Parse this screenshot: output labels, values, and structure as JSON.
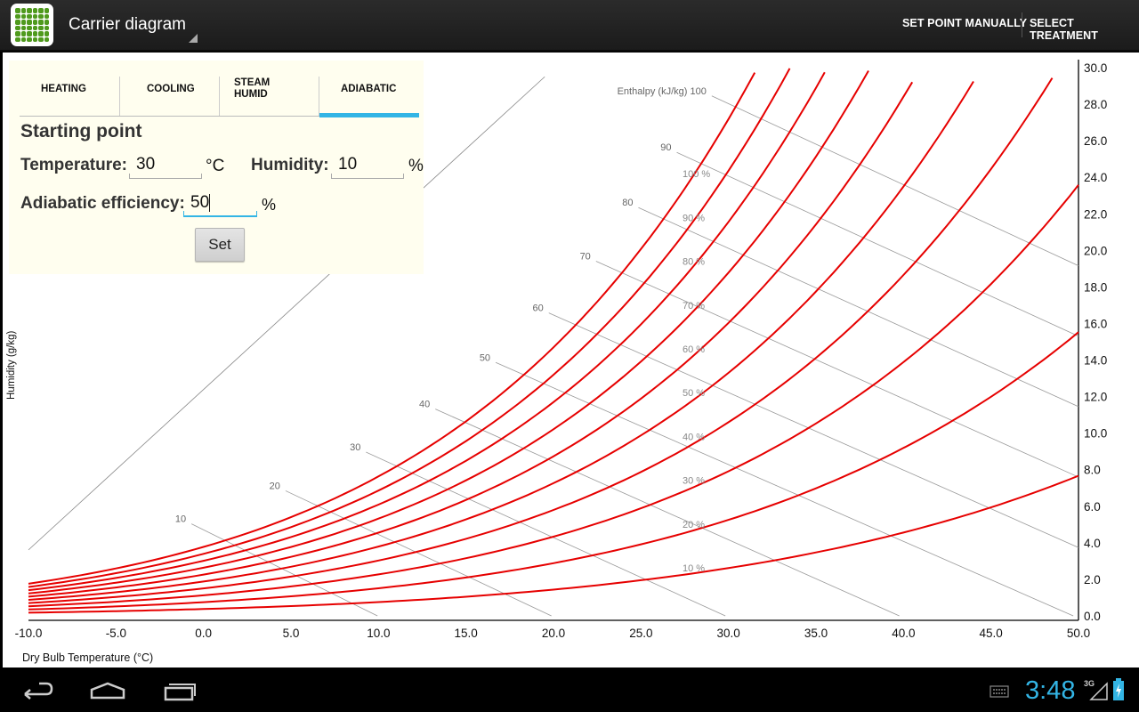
{
  "app": {
    "title": "Carrier diagram"
  },
  "actions": {
    "set_point_manually": "SET POINT MANUALLY",
    "select_treatment": "SELECT TREATMENT"
  },
  "tabs": [
    {
      "label": "HEATING",
      "active": false
    },
    {
      "label": "COOLING",
      "active": false
    },
    {
      "label": "STEAM HUMID",
      "active": false
    },
    {
      "label": "ADIABATIC",
      "active": true
    }
  ],
  "form": {
    "heading": "Starting point",
    "temperature_label": "Temperature:",
    "temperature_value": "30",
    "temperature_unit": "°C",
    "humidity_label": "Humidity:",
    "humidity_value": "10",
    "humidity_unit": "%",
    "efficiency_label": "Adiabatic efficiency:",
    "efficiency_value": "50",
    "efficiency_unit": "%",
    "set_label": "Set"
  },
  "status": {
    "time": "3:48",
    "network": "3G"
  },
  "colors": {
    "accent": "#33b5e5",
    "curve": "#e60000",
    "panel": "#fffeef"
  },
  "chart_data": {
    "type": "line",
    "xlabel": "Dry Bulb Temperature (°C)",
    "ylabel": "Humidity (g/kg)",
    "enthalpy_label": "Enthalpy (kJ/kg)",
    "xlim": [
      -10,
      50
    ],
    "ylim": [
      0,
      30
    ],
    "x_ticks": [
      "-10.0",
      "-5.0",
      "0.0",
      "5.0",
      "10.0",
      "15.0",
      "20.0",
      "25.0",
      "30.0",
      "35.0",
      "40.0",
      "45.0",
      "50.0"
    ],
    "y_ticks": [
      "0.0",
      "2.0",
      "4.0",
      "6.0",
      "8.0",
      "10.0",
      "12.0",
      "14.0",
      "16.0",
      "18.0",
      "20.0",
      "22.0",
      "24.0",
      "26.0",
      "28.0",
      "30.0"
    ],
    "relative_humidity_curves": [
      10,
      20,
      30,
      40,
      50,
      60,
      70,
      80,
      90,
      100
    ],
    "rh_labels": [
      "10 %",
      "20 %",
      "30 %",
      "40 %",
      "50 %",
      "60 %",
      "70 %",
      "80 %",
      "90 %",
      "100 %"
    ],
    "enthalpy_lines": [
      10,
      20,
      30,
      40,
      50,
      60,
      70,
      80,
      90,
      100
    ],
    "enthalpy_labels": [
      "10",
      "20",
      "30",
      "40",
      "50",
      "60",
      "70",
      "80",
      "90",
      "100"
    ],
    "grid": true
  }
}
